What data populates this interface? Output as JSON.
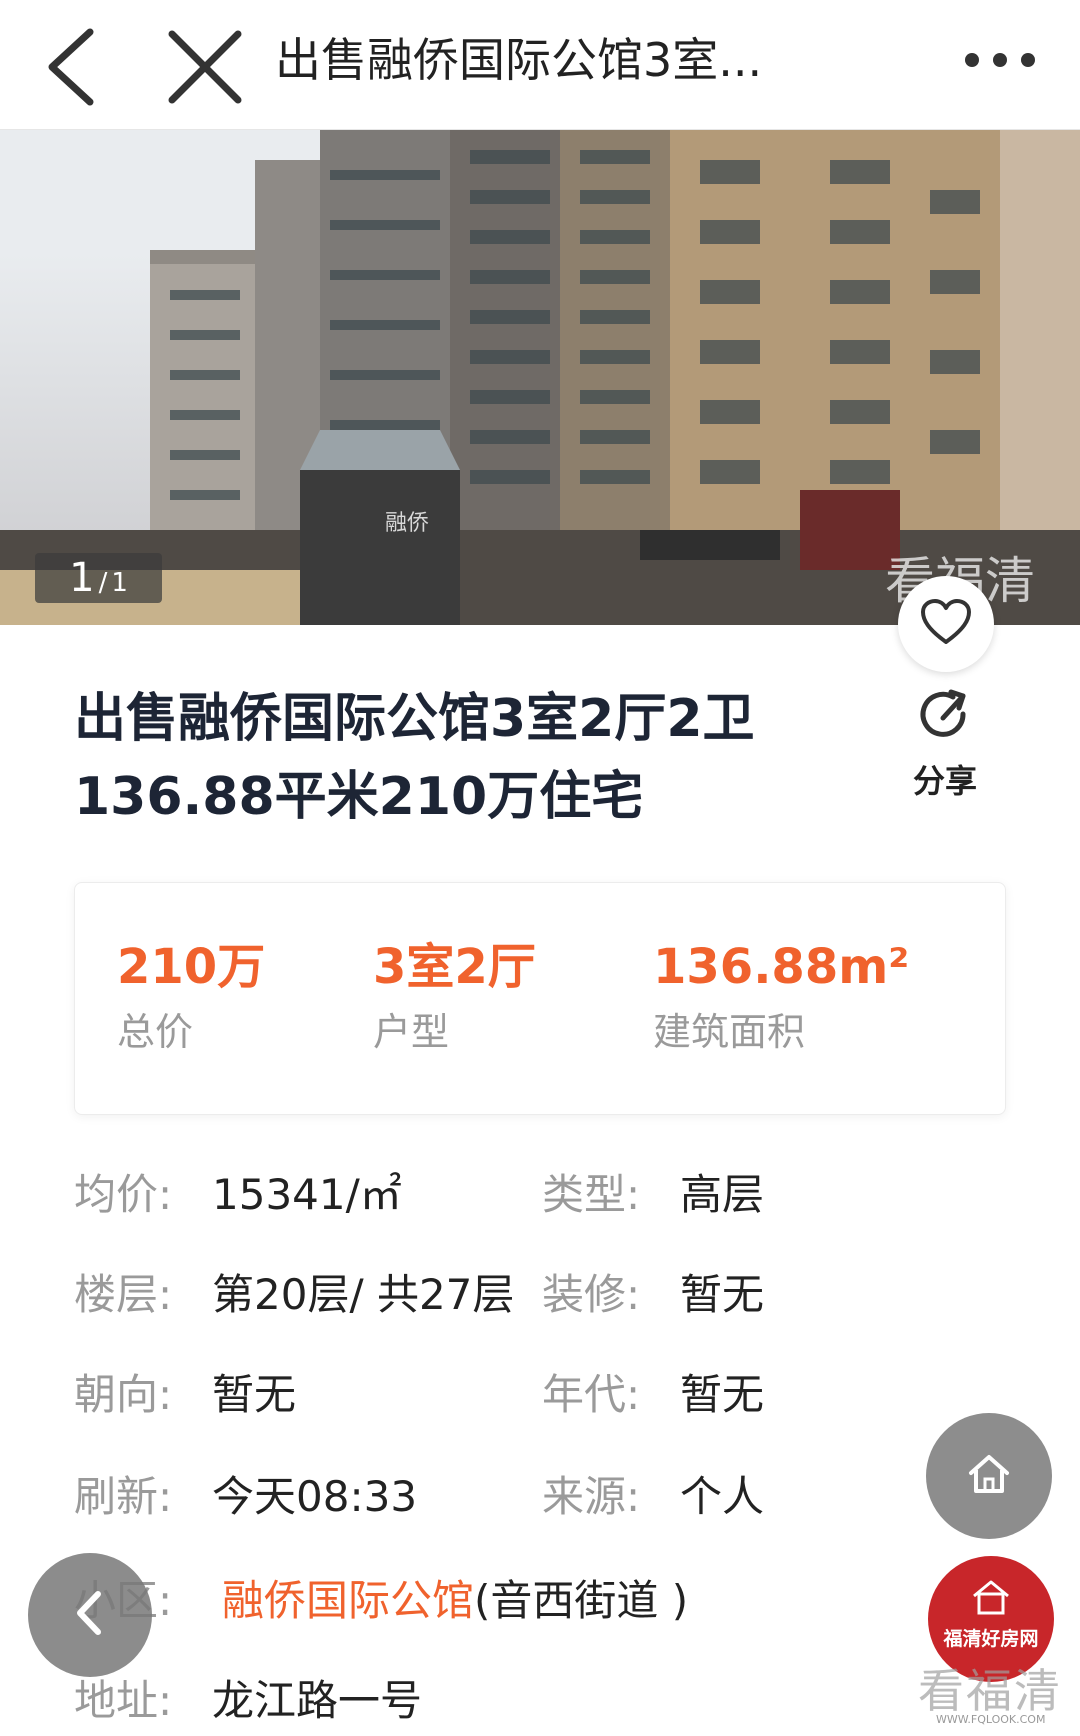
{
  "topbar": {
    "title": "出售融侨国际公馆3室...",
    "icons": [
      "chevron-left-icon",
      "close-icon",
      "more-dots-icon"
    ]
  },
  "hero": {
    "counter_current": "1",
    "counter_sep": "/",
    "counter_total": "1",
    "sign_1": "融侨",
    "watermark": "看福清"
  },
  "listing": {
    "title": "出售融侨国际公馆3室2厅2卫136.88平米210万住宅",
    "share_label": "分享"
  },
  "summary": {
    "price_value": "210万",
    "price_label": "总价",
    "layout_value": "3室2厅",
    "layout_label": "户型",
    "area_value": "136.88m²",
    "area_label": "建筑面积"
  },
  "details": {
    "unit_price_key": "均价:",
    "unit_price_val": "15341/㎡",
    "type_key": "类型:",
    "type_val": "高层",
    "floor_key": "楼层:",
    "floor_val": "第20层/ 共27层",
    "decor_key": "装修:",
    "decor_val": "暂无",
    "orient_key": "朝向:",
    "orient_val": "暂无",
    "year_key": "年代:",
    "year_val": "暂无",
    "refresh_key": "刷新:",
    "refresh_val": "今天08:33",
    "source_key": "来源:",
    "source_val": "个人",
    "community_key": "小区:",
    "community_link": "融侨国际公馆",
    "community_extra": "(音西街道 )",
    "address_key": "地址:",
    "address_val": "龙江路一号"
  },
  "badge": {
    "logo_text": "福清好房网",
    "watermark_text": "看福清",
    "watermark_url": "WWW.FQLOOK.COM"
  },
  "colors": {
    "accent": "#f0622d",
    "muted": "#9a9a9a",
    "title": "#1d2535",
    "badge": "#c8262a"
  }
}
